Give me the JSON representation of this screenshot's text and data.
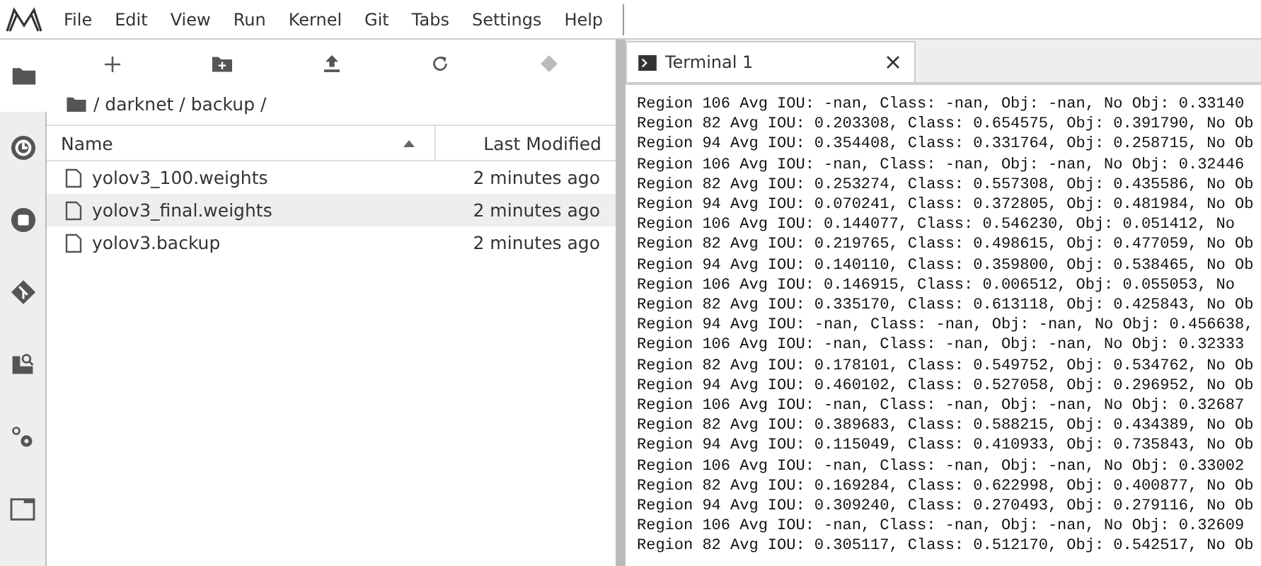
{
  "menu_bar": {
    "items": [
      "File",
      "Edit",
      "View",
      "Run",
      "Kernel",
      "Git",
      "Tabs",
      "Settings",
      "Help"
    ]
  },
  "activity_bar": {
    "items": [
      {
        "kind": "folder",
        "selected": true
      },
      {
        "kind": "running",
        "selected": false
      },
      {
        "kind": "stop",
        "selected": false
      },
      {
        "kind": "git",
        "selected": false
      },
      {
        "kind": "inspector",
        "selected": false
      },
      {
        "kind": "extensions",
        "selected": false
      },
      {
        "kind": "tabs",
        "selected": false
      }
    ]
  },
  "file_browser": {
    "toolbar": [
      {
        "kind": "new-launcher",
        "disabled": false
      },
      {
        "kind": "new-folder",
        "disabled": false
      },
      {
        "kind": "upload",
        "disabled": false
      },
      {
        "kind": "refresh",
        "disabled": false
      },
      {
        "kind": "git-clone",
        "disabled": true
      }
    ],
    "breadcrumb": "/ darknet / backup /",
    "columns": [
      "Name",
      "Last Modified"
    ],
    "rows": [
      {
        "name": "yolov3_100.weights",
        "modified": "2 minutes ago",
        "selected": false
      },
      {
        "name": "yolov3_final.weights",
        "modified": "2 minutes ago",
        "selected": true
      },
      {
        "name": "yolov3.backup",
        "modified": "2 minutes ago",
        "selected": false
      }
    ]
  },
  "terminal": {
    "tab_title": "Terminal 1",
    "lines": [
      "Region 106 Avg IOU: -nan, Class: -nan, Obj: -nan, No Obj: 0.33140",
      "Region 82 Avg IOU: 0.203308, Class: 0.654575, Obj: 0.391790, No Ob",
      "Region 94 Avg IOU: 0.354408, Class: 0.331764, Obj: 0.258715, No Ob",
      "Region 106 Avg IOU: -nan, Class: -nan, Obj: -nan, No Obj: 0.32446",
      "Region 82 Avg IOU: 0.253274, Class: 0.557308, Obj: 0.435586, No Ob",
      "Region 94 Avg IOU: 0.070241, Class: 0.372805, Obj: 0.481984, No Ob",
      "Region 106 Avg IOU: 0.144077, Class: 0.546230, Obj: 0.051412, No",
      "Region 82 Avg IOU: 0.219765, Class: 0.498615, Obj: 0.477059, No Ob",
      "Region 94 Avg IOU: 0.140110, Class: 0.359800, Obj: 0.538465, No Ob",
      "Region 106 Avg IOU: 0.146915, Class: 0.006512, Obj: 0.055053, No",
      "Region 82 Avg IOU: 0.335170, Class: 0.613118, Obj: 0.425843, No Ob",
      "Region 94 Avg IOU: -nan, Class: -nan, Obj: -nan, No Obj: 0.456638,",
      "Region 106 Avg IOU: -nan, Class: -nan, Obj: -nan, No Obj: 0.32333",
      "Region 82 Avg IOU: 0.178101, Class: 0.549752, Obj: 0.534762, No Ob",
      "Region 94 Avg IOU: 0.460102, Class: 0.527058, Obj: 0.296952, No Ob",
      "Region 106 Avg IOU: -nan, Class: -nan, Obj: -nan, No Obj: 0.32687",
      "Region 82 Avg IOU: 0.389683, Class: 0.588215, Obj: 0.434389, No Ob",
      "Region 94 Avg IOU: 0.115049, Class: 0.410933, Obj: 0.735843, No Ob",
      "Region 106 Avg IOU: -nan, Class: -nan, Obj: -nan, No Obj: 0.33002",
      "Region 82 Avg IOU: 0.169284, Class: 0.622998, Obj: 0.400877, No Ob",
      "Region 94 Avg IOU: 0.309240, Class: 0.270493, Obj: 0.279116, No Ob",
      "Region 106 Avg IOU: -nan, Class: -nan, Obj: -nan, No Obj: 0.32609",
      "Region 82 Avg IOU: 0.305117, Class: 0.512170, Obj: 0.542517, No Ob"
    ]
  }
}
